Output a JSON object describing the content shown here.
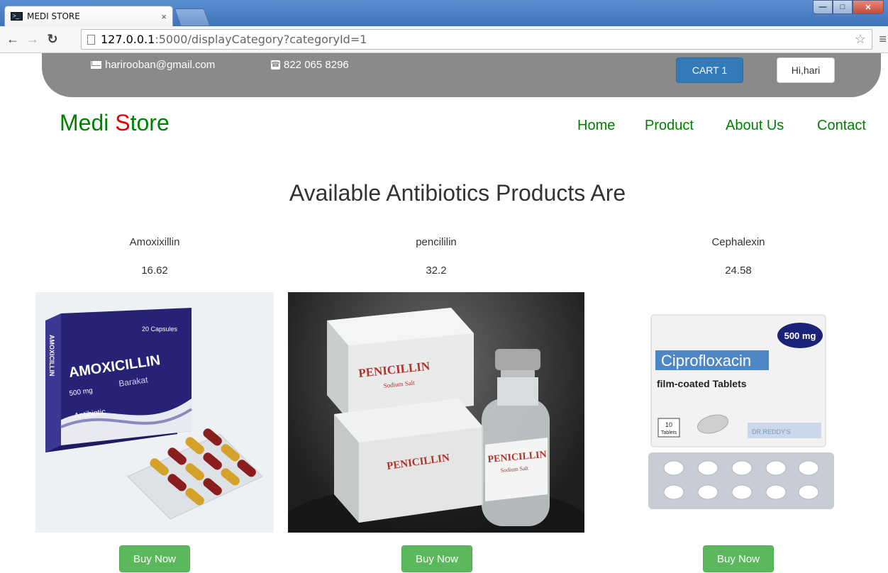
{
  "browser": {
    "tab_title": "MEDI STORE",
    "tab_close": "×",
    "url_host": "127.0.0.1",
    "url_path": ":5000/displayCategory?categoryId=1"
  },
  "topbar": {
    "email": "harirooban@gmail.com",
    "phone": "822 065 8296",
    "cart_label": "CART 1",
    "user_label": "Hi,hari"
  },
  "brand": {
    "part1": "Medi ",
    "part2": "S",
    "part3": "tore"
  },
  "nav": {
    "items": [
      "Home",
      "Product",
      "About Us",
      "Contact"
    ]
  },
  "heading": "Available Antibiotics Products Are",
  "products": [
    {
      "name": "Amoxixillin",
      "price": "16.62",
      "buy": "Buy Now",
      "img": {
        "count": "20 Capsules",
        "title": "AMOXICILLIN",
        "sub": "Barakat",
        "dose": "500 mg",
        "kind": "Antibiotic",
        "side": "AMOXICILLIN"
      }
    },
    {
      "name": "pencililin",
      "price": "32.2",
      "buy": "Buy Now",
      "img": {
        "label": "PENICILLIN",
        "sub": "Sodium Salt"
      }
    },
    {
      "name": "Cephalexin",
      "price": "24.58",
      "buy": "Buy Now",
      "img": {
        "dose": "500 mg",
        "title": "Ciprofloxacin",
        "sub": "film-coated Tablets",
        "count": "10",
        "count_unit": "Tablets",
        "maker": "DR.REDDY'S"
      }
    }
  ],
  "colors": {
    "brand_green": "#008000",
    "brand_red": "#e00000",
    "cart_blue": "#337ab7",
    "buy_green": "#5cb85c",
    "topbar_gray": "#8a8a8a"
  }
}
